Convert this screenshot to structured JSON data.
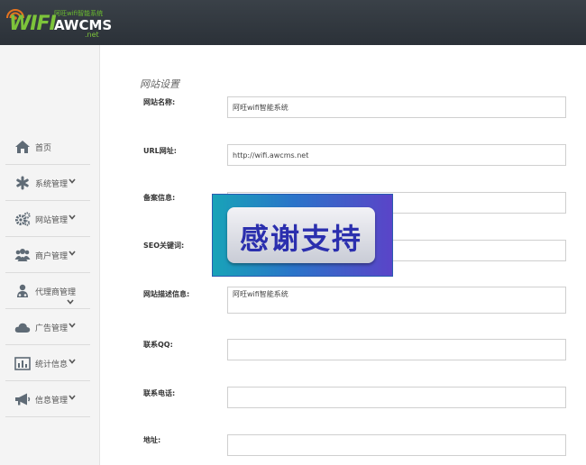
{
  "header": {
    "logo": {
      "tagline": "阿旺wifi智能系统",
      "wifi": "WIFI",
      "brand": "AWCMS",
      "suffix": ".net"
    }
  },
  "sidebar": {
    "items": [
      {
        "label": "首页",
        "icon": "home-icon",
        "has_submenu": false
      },
      {
        "label": "系统管理",
        "icon": "asterisk-icon",
        "has_submenu": true
      },
      {
        "label": "网站管理",
        "icon": "cogs-icon",
        "has_submenu": true
      },
      {
        "label": "商户管理",
        "icon": "users-icon",
        "has_submenu": true
      },
      {
        "label": "代理商管理",
        "icon": "agent-icon",
        "has_submenu": true
      },
      {
        "label": "广告管理",
        "icon": "cloud-icon",
        "has_submenu": true
      },
      {
        "label": "统计信息",
        "icon": "bar-chart-icon",
        "has_submenu": true
      },
      {
        "label": "信息管理",
        "icon": "bullhorn-icon",
        "has_submenu": true
      }
    ]
  },
  "main": {
    "title": "网站设置",
    "fields": [
      {
        "label": "网站名称:",
        "value": "阿旺wifi智能系统"
      },
      {
        "label": "URL网址:",
        "value": "http://wifi.awcms.net"
      },
      {
        "label": "备案信息:",
        "value": ""
      },
      {
        "label": "SEO关键词:",
        "value": ""
      },
      {
        "label": "网站描述信息:",
        "value": "阿旺wifi智能系统"
      },
      {
        "label": "联系QQ:",
        "value": ""
      },
      {
        "label": "联系电话:",
        "value": ""
      },
      {
        "label": "地址:",
        "value": ""
      }
    ]
  },
  "overlay": {
    "text": "感谢支持"
  },
  "colors": {
    "header_bg": "#2f353c",
    "sidebar_bg": "#f4f4f4",
    "icon_color": "#5f6b76",
    "logo_green": "#7dc43a",
    "banner_text": "#2b2fae"
  }
}
